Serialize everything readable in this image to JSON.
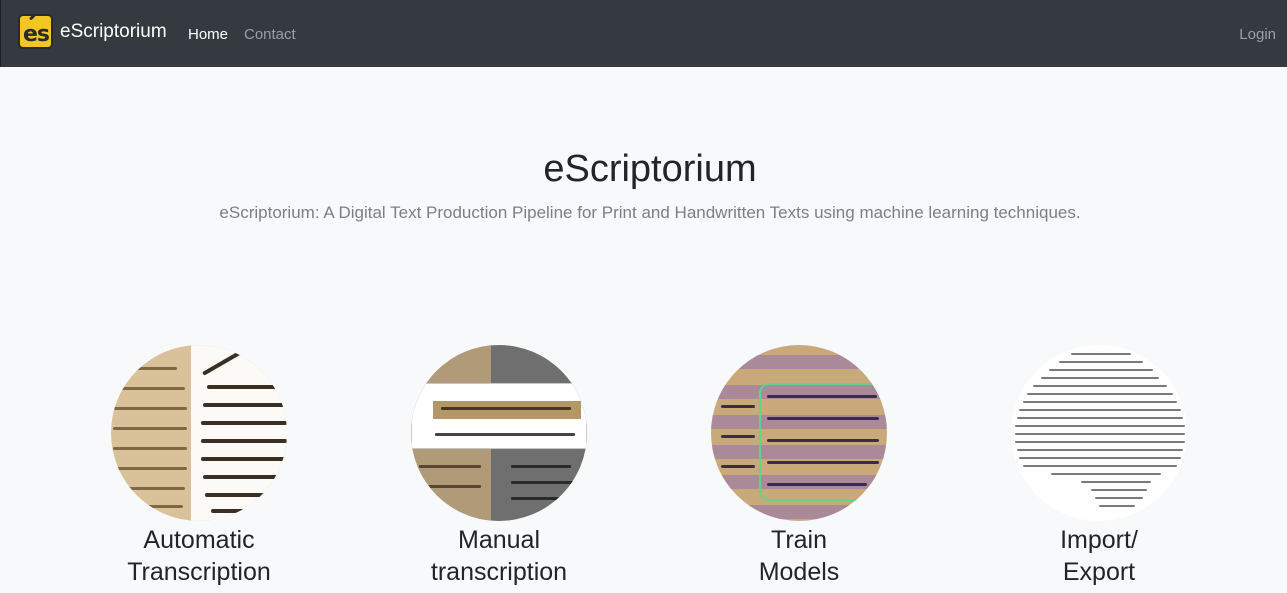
{
  "navbar": {
    "brand_text": "eScriptorium",
    "logo_text": "es",
    "links": [
      {
        "label": "Home"
      },
      {
        "label": "Contact"
      }
    ],
    "login_label": "Login"
  },
  "hero": {
    "title": "eScriptorium",
    "lead": "eScriptorium: A Digital Text Production Pipeline for Print and Handwritten Texts using machine learning techniques."
  },
  "features": [
    {
      "line1": "Automatic",
      "line2": "Transcription"
    },
    {
      "line1": "Manual",
      "line2": "transcription"
    },
    {
      "line1": "Train",
      "line2": "Models"
    },
    {
      "line1": "Import/",
      "line2": "Export"
    }
  ],
  "colors": {
    "navbar_bg": "#343a40",
    "page_bg": "#f8f9fa",
    "logo_bg": "#f3c623"
  }
}
